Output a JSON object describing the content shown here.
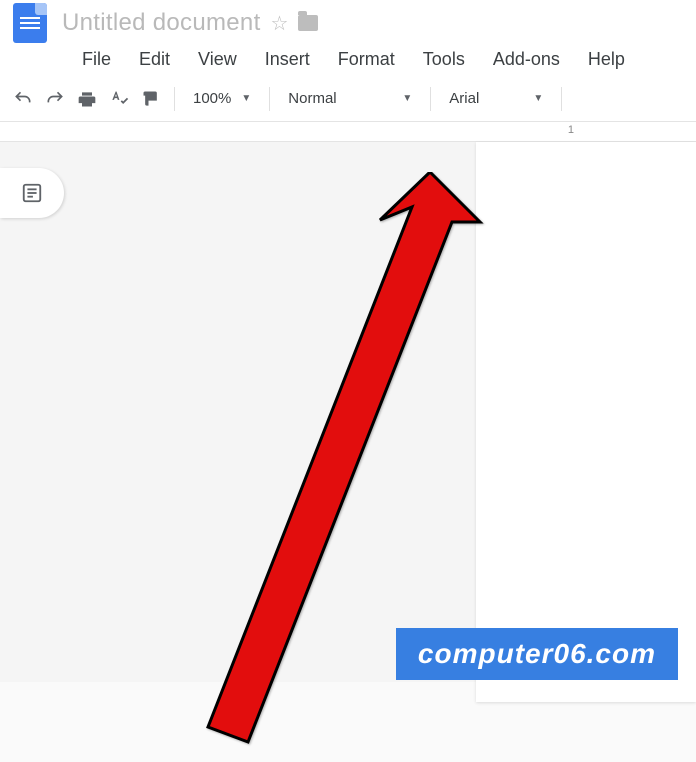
{
  "document": {
    "title": "Untitled document"
  },
  "menu": {
    "items": [
      "File",
      "Edit",
      "View",
      "Insert",
      "Format",
      "Tools",
      "Add-ons",
      "Help"
    ]
  },
  "toolbar": {
    "zoom": "100%",
    "style": "Normal",
    "font": "Arial"
  },
  "ruler": {
    "marks": "1"
  },
  "watermark": "computer06.com"
}
